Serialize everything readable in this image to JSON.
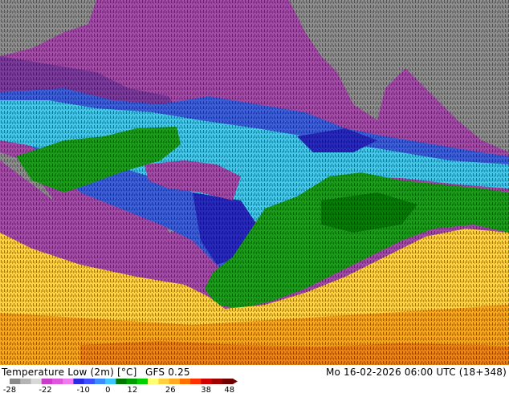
{
  "footer": {
    "title": "Temperature Low (2m) [°C]",
    "product": "GFS 0.25",
    "valid_time": "Mo 16-02-2026 06:00 UTC (18+348)"
  },
  "legend": {
    "ticks": [
      "-28",
      "-22",
      "-10",
      "0",
      "12",
      "26",
      "38",
      "48"
    ],
    "colors": [
      "#8a8a8a",
      "#b4b4b4",
      "#d8d8d8",
      "#c83cc8",
      "#e055e0",
      "#f07af0",
      "#2a2ae0",
      "#3c50ff",
      "#3c8cff",
      "#3cc8ff",
      "#007800",
      "#00a000",
      "#00d200",
      "#ffff70",
      "#ffd040",
      "#ffaa20",
      "#ff7000",
      "#ff3000",
      "#d00000",
      "#a00000",
      "#700000"
    ]
  },
  "map_palette": {
    "gray": "#8f8f8f",
    "magenta": "#a24ea6",
    "purple": "#7a3e9a",
    "blue": "#3f5fd6",
    "dark_blue": "#2a2ab8",
    "cyan": "#49c7e8",
    "green": "#1f9a1f",
    "dark_green": "#0a7a0a",
    "yellow": "#ffd24a",
    "orange": "#f5a623",
    "deep_orange": "#e8841a"
  }
}
